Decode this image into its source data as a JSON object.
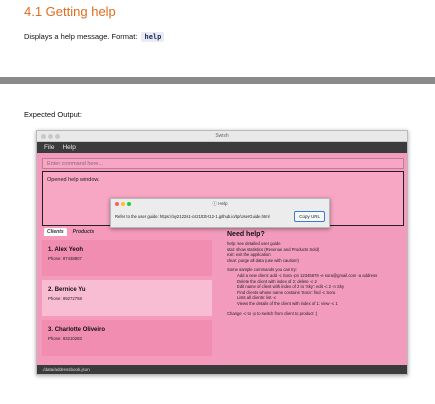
{
  "doc": {
    "heading": "4.1 Getting help",
    "description": "Displays a help message. Format:",
    "format_code": "help",
    "expected_label": "Expected Output:"
  },
  "window": {
    "title": "Swish",
    "menu": [
      "File",
      "Help"
    ],
    "command_placeholder": "Enter command here...",
    "result_text": "Opened help window.",
    "status_path": "./data/addressbook.json"
  },
  "tabs": [
    "Clients",
    "Products"
  ],
  "clients": [
    {
      "index": "1.",
      "name": "Alex Yeoh",
      "phone": "Phone: 87438807"
    },
    {
      "index": "2.",
      "name": "Bernice Yu",
      "phone": "Phone: 99272758"
    },
    {
      "index": "3.",
      "name": "Charlotte Oliveiro",
      "phone": "Phone: 93210283"
    }
  ],
  "help_panel": {
    "title": "Need help?",
    "lines": [
      {
        "text": "help: see detailed user guide",
        "indent": false
      },
      {
        "text": "stat: show statistics (Revenue and Products Sold)",
        "indent": false
      },
      {
        "text": "exit: exit the application",
        "indent": false
      },
      {
        "text": "clear: purge all data (use with caution!)",
        "indent": false
      },
      {
        "text": "",
        "indent": false
      },
      {
        "text": "Some sample commands you can try:",
        "indent": false
      },
      {
        "text": "Add a new client: add -c Sora -pn 12345678 -e sora@gmail.com -a address",
        "indent": true
      },
      {
        "text": "Delete the client with index of 2: delete -c 2",
        "indent": true
      },
      {
        "text": "Edit name of client with index of 2 to 'Sky': edit -c 2 -n Sky",
        "indent": true
      },
      {
        "text": "Find clients whose name contains 'Sora': find -c Sora",
        "indent": true
      },
      {
        "text": "Lists all clients: list -c",
        "indent": true
      },
      {
        "text": "Views the details of the client with index of 1: view -c 1",
        "indent": true
      },
      {
        "text": "",
        "indent": false
      },
      {
        "text": "Change -c to -p to switch from client to product :)",
        "indent": false
      }
    ]
  },
  "help_popup": {
    "title": "Help",
    "message": "Refer to the user guide: https://ay2122s1-cs2103t-t12-1.github.io/tp/UserGuide.html",
    "copy_label": "Copy URL"
  },
  "colors": {
    "heading": "#e06c1f",
    "window_bg": "#f29bbd",
    "selected_card": "#f9bdd3",
    "menubar": "#3b3b3b"
  }
}
